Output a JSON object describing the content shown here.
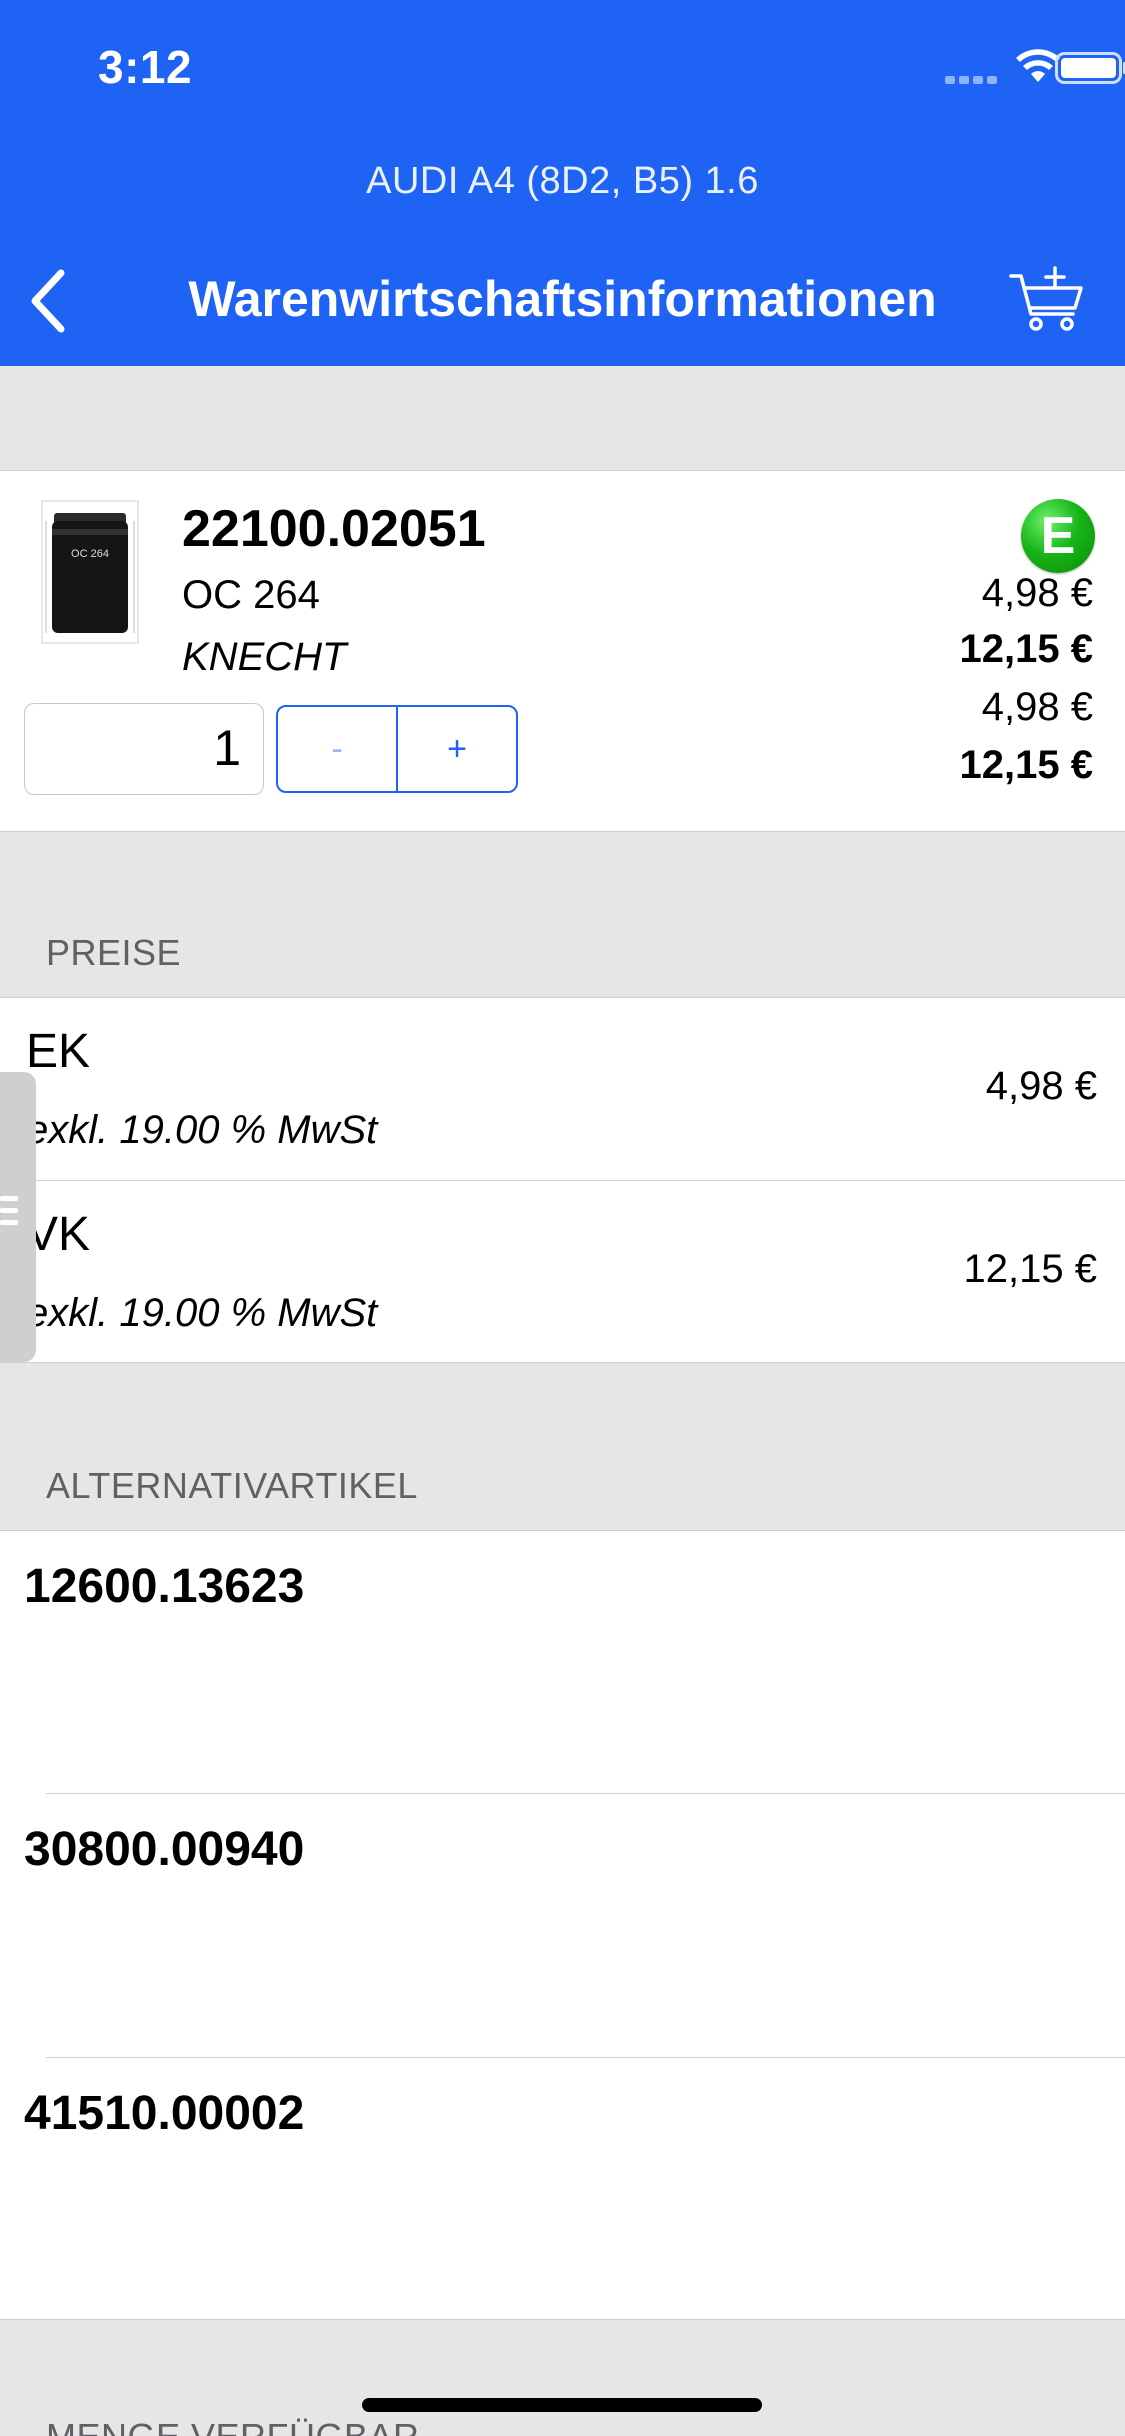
{
  "status_bar": {
    "time": "3:12"
  },
  "header": {
    "vehicle": "AUDI A4 (8D2, B5) 1.6",
    "title": "Warenwirtschaftsinformationen",
    "back_icon": "chevron-left-icon",
    "cart_icon": "cart-add-icon",
    "background_color": "#1f63f5"
  },
  "product": {
    "number": "22100.02051",
    "code": "OC 264",
    "brand": "KNECHT",
    "image_label": "OC 264",
    "quantity": "1",
    "stepper_minus": "-",
    "stepper_plus": "+",
    "badge": "E",
    "badge_color": "#17b617",
    "prices": [
      "4,98 €",
      "12,15 €",
      "4,98 €",
      "12,15 €"
    ]
  },
  "prices_section": {
    "header": "PREISE",
    "rows": [
      {
        "label": "EK",
        "sub": "exkl. 19.00 % MwSt",
        "value": "4,98 €"
      },
      {
        "label": "VK",
        "sub": "exkl. 19.00 % MwSt",
        "value": "12,15 €"
      }
    ]
  },
  "alternatives_section": {
    "header": "ALTERNATIVARTIKEL",
    "items": [
      "12600.13623",
      "30800.00940",
      "41510.00002"
    ]
  },
  "next_section": {
    "header": "MENGE VERFÜGBAR"
  }
}
